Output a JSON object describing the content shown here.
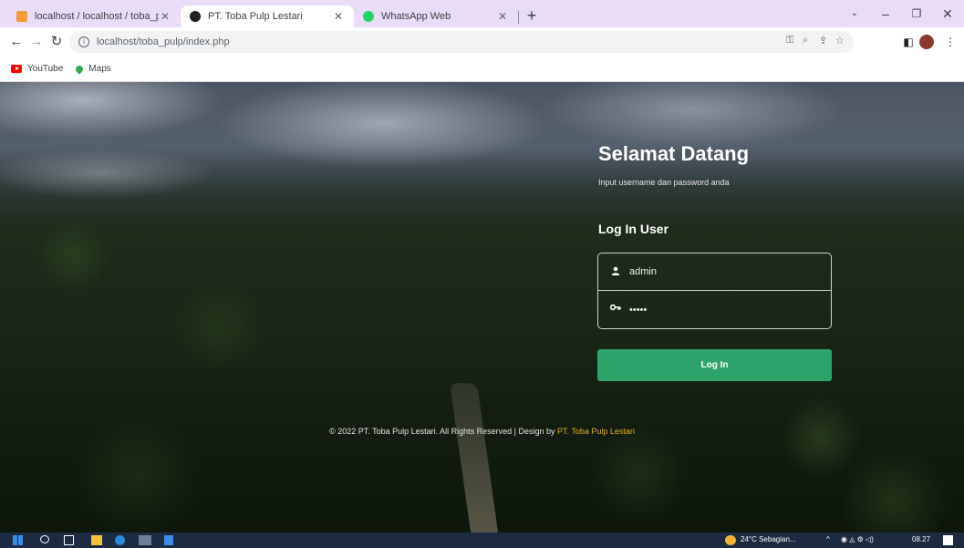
{
  "browser": {
    "tabs": [
      {
        "title": "localhost / localhost / toba_pulp",
        "favicon_color": "#f29c3b",
        "active": false
      },
      {
        "title": "PT. Toba Pulp Lestari",
        "favicon_color": "#202124",
        "active": true
      },
      {
        "title": "WhatsApp Web",
        "favicon_color": "#25d366",
        "active": false
      }
    ],
    "new_tab_label": "+",
    "address": "localhost/toba_pulp/index.php",
    "bookmarks": [
      {
        "label": "YouTube"
      },
      {
        "label": "Maps"
      }
    ]
  },
  "login": {
    "heading": "Selamat Datang",
    "subheading": "Input username dan password anda",
    "form_title": "Log In User",
    "username_value": "admin",
    "password_value": "admin",
    "button_label": "Log In"
  },
  "footer": {
    "copyright": "© 2022 PT. Toba Pulp Lestari. All Rights Reserved | Design by ",
    "brand": "PT. Toba Pulp Lestari"
  },
  "taskbar": {
    "weather": "24°C Sebagian...",
    "time": "08.27"
  },
  "colors": {
    "accent": "#2fa46a",
    "brand_link": "#e0b02c",
    "tabstrip": "#e8dcf7"
  }
}
